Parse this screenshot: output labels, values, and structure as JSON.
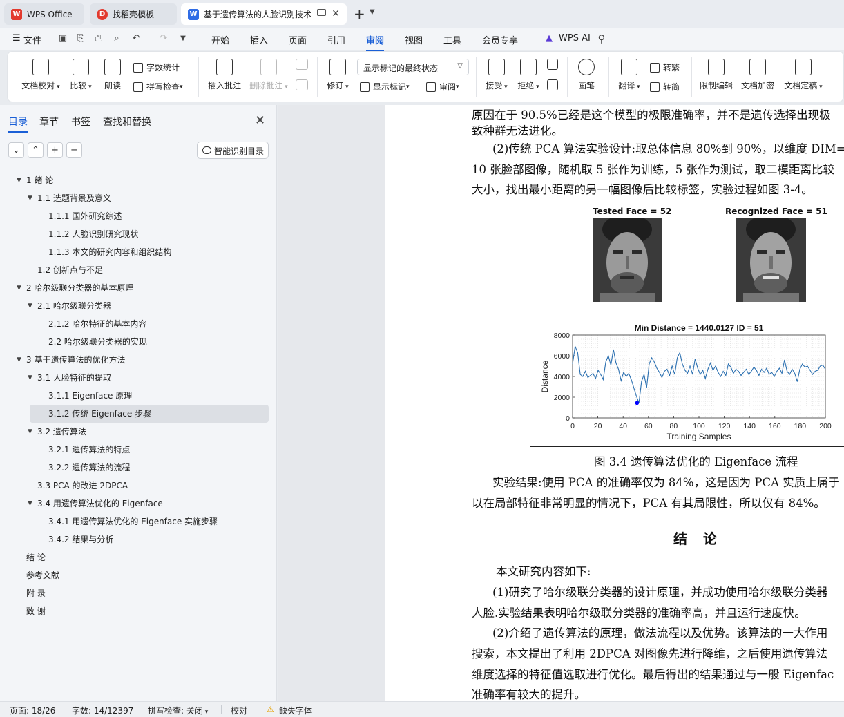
{
  "tabs": [
    {
      "label": "WPS Office"
    },
    {
      "label": "找稻壳模板"
    },
    {
      "label": "基于遗传算法的人脸识别技术"
    }
  ],
  "menu": {
    "file": "文件",
    "items": [
      "开始",
      "插入",
      "页面",
      "引用",
      "审阅",
      "视图",
      "工具",
      "会员专享"
    ],
    "wps_ai": "WPS AI"
  },
  "ribbon": {
    "doc_proof": "文档校对",
    "compare": "比较",
    "read_aloud": "朗读",
    "word_count": "字数统计",
    "spell_check": "拼写检查",
    "insert_comment": "插入批注",
    "delete_comment": "删除批注",
    "revise": "修订",
    "display_state": "显示标记的最终状态",
    "show_marks": "显示标记",
    "review": "审阅",
    "accept": "接受",
    "reject": "拒绝",
    "pen": "画笔",
    "translate": "翻译",
    "to_traditional": "转繁",
    "to_simplified": "转简",
    "restrict_edit": "限制编辑",
    "encrypt": "文档加密",
    "finalize": "文档定稿"
  },
  "nav": {
    "tabs": [
      "目录",
      "章节",
      "书签",
      "查找和替换"
    ],
    "smart_toc": "智能识别目录",
    "toc": [
      {
        "label": "1 绪  论",
        "level": 1,
        "arrow": true
      },
      {
        "label": "1.1  选题背景及意义",
        "level": 2,
        "arrow": true
      },
      {
        "label": "1.1.1  国外研究综述",
        "level": 3
      },
      {
        "label": "1.1.2  人脸识别研究现状",
        "level": 3
      },
      {
        "label": "1.1.3 本文的研究内容和组织结构",
        "level": 3
      },
      {
        "label": "1.2  创新点与不足",
        "level": 2
      },
      {
        "label": "2 哈尔级联分类器的基本原理",
        "level": 1,
        "arrow": true
      },
      {
        "label": "2.1 哈尔级联分类器",
        "level": 2,
        "arrow": true
      },
      {
        "label": "2.1.2 哈尔特征的基本内容",
        "level": 3
      },
      {
        "label": "2.2  哈尔级联分类器的实现",
        "level": 3
      },
      {
        "label": "3 基于遗传算法的优化方法",
        "level": 1,
        "arrow": true
      },
      {
        "label": "3.1 人脸特征的提取",
        "level": 2,
        "arrow": true
      },
      {
        "label": "3.1.1 Eigenface 原理",
        "level": 3
      },
      {
        "label": "3.1.2 传统 Eigenface 步骤",
        "level": 3,
        "selected": true
      },
      {
        "label": "3.2  遗传算法",
        "level": 2,
        "arrow": true
      },
      {
        "label": "3.2.1 遗传算法的特点",
        "level": 3
      },
      {
        "label": "3.2.2  遗传算法的流程",
        "level": 3
      },
      {
        "label": "3.3 PCA 的改进 2DPCA",
        "level": 2
      },
      {
        "label": "3.4  用遗传算法优化的 Eigenface",
        "level": 2,
        "arrow": true
      },
      {
        "label": "3.4.1 用遗传算法优化的 Eigenface 实施步骤",
        "level": 3
      },
      {
        "label": "3.4.2  结果与分析",
        "level": 3
      },
      {
        "label": "结 论",
        "level": 1
      },
      {
        "label": "参考文献",
        "level": 1
      },
      {
        "label": "附 录",
        "level": 1
      },
      {
        "label": "致 谢",
        "level": 1
      }
    ]
  },
  "document": {
    "lines": [
      "原因在于 90.5%已经是这个模型的极限准确率，并不是遗传选择出现极",
      "致种群无法进化。",
      "(2)传统 PCA 算法实验设计:取总体信息 80%到 90%，以维度 DIM=",
      "10 张脸部图像，随机取 5 张作为训练，5 张作为测试，取二模距离比较",
      "大小，找出最小距离的另一幅图像后比较标签，实验过程如图 3-4。"
    ],
    "figure_caption": "图 3.4  遗传算法优化的 Eigenface 流程",
    "result_lines": [
      "实验结果:使用 PCA 的准确率仅为 84%，这是因为 PCA 实质上属于",
      "以在局部特征非常明显的情况下，PCA 有其局限性，所以仅有 84%。"
    ],
    "heading": "结 论",
    "conclusion_lines": [
      "本文研究内容如下:",
      "(1)研究了哈尔级联分类器的设计原理，并成功使用哈尔级联分类器",
      "人脸.实验结果表明哈尔级联分类器的准确率高，并且运行速度快。",
      "(2)介绍了遗传算法的原理，做法流程以及优势。该算法的一大作用",
      "搜索，本文提出了利用 2DPCA 对图像先进行降维，之后使用遗传算法",
      "维度选择的特征值选取进行优化。最后得出的结果通过与一般 Eigenfac",
      "准确率有较大的提升。"
    ]
  },
  "figure": {
    "tested_face": "Tested Face = 52",
    "recognized_face": "Recognized Face = 51"
  },
  "chart_data": {
    "type": "line",
    "title": "Min Distance = 1440.0127 ID = 51",
    "xlabel": "Training Samples",
    "ylabel": "Distance",
    "xlim": [
      0,
      200
    ],
    "ylim": [
      0,
      8000
    ],
    "xticks": [
      0,
      20,
      40,
      60,
      80,
      100,
      120,
      140,
      160,
      180,
      200
    ],
    "yticks": [
      0,
      2000,
      4000,
      6000,
      8000
    ],
    "grid": true,
    "series": [
      {
        "color": "#2a6fb0",
        "y": [
          5200,
          6900,
          6300,
          4200,
          4000,
          4500,
          3900,
          4100,
          4300,
          3800,
          4600,
          4200,
          3700,
          5400,
          6000,
          5100,
          6600,
          5300,
          4700,
          3600,
          4400,
          4000,
          4300,
          3700,
          2900,
          2100,
          1440,
          3500,
          4200,
          2900,
          5200,
          5800,
          5400,
          4800,
          4400,
          3900,
          4500,
          4700,
          4100,
          5000,
          4200,
          5800,
          6300,
          5200,
          4600,
          4300,
          5000,
          4200,
          5700,
          4800,
          4200,
          4600,
          3800,
          4700,
          5300,
          4600,
          5000,
          4400,
          4000,
          4500,
          4100,
          5200,
          4900,
          4300,
          4700,
          4500,
          4100,
          4400,
          4700,
          4200,
          4500,
          4900,
          4600,
          4100,
          4700,
          4400,
          4800,
          4200,
          4400,
          4000,
          4500,
          4800,
          4300,
          5600,
          4500,
          4200,
          4700,
          4300,
          3500,
          4700,
          5200,
          4900,
          5000,
          4600,
          4200,
          4500,
          4600,
          5000,
          5100,
          4700
        ]
      },
      {
        "type": "scatter",
        "x": [
          51
        ],
        "y": [
          1440.0127
        ],
        "color": "#0000ff"
      }
    ]
  },
  "statusbar": {
    "page": "页面: 18/26",
    "words": "字数: 14/12397",
    "spell": "拼写检查: 关闭",
    "proof": "校对",
    "missing_font": "缺失字体"
  }
}
